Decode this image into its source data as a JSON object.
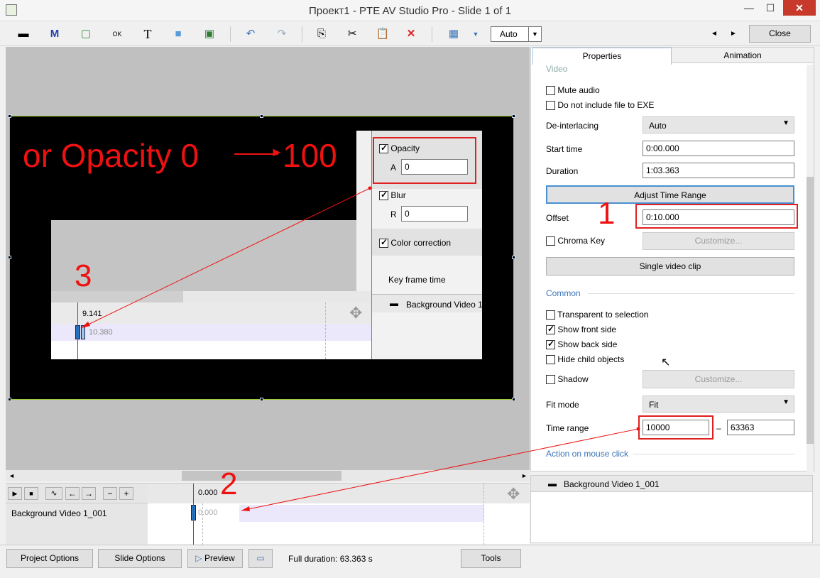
{
  "window": {
    "title": "Проект1 - PTE AV Studio Pro - Slide 1 of 1",
    "min": "—",
    "max": "☐",
    "close": "✕"
  },
  "toolbar": {
    "zoom_value": "Auto",
    "close_label": "Close",
    "prev": "◄",
    "next": "►"
  },
  "tabs": {
    "properties": "Properties",
    "animation": "Animation"
  },
  "props": {
    "video_section": "Video",
    "mute_audio": "Mute audio",
    "no_exe": "Do not include file to EXE",
    "deinterlacing_label": "De-interlacing",
    "deinterlacing_value": "Auto",
    "start_time_label": "Start time",
    "start_time_value": "0:00.000",
    "duration_label": "Duration",
    "duration_value": "1:03.363",
    "adjust_btn": "Adjust Time Range",
    "offset_label": "Offset",
    "offset_value": "0:10.000",
    "chroma_key": "Chroma Key",
    "customize": "Customize...",
    "single_clip": "Single video clip",
    "common_section": "Common",
    "transparent": "Transparent to selection",
    "show_front": "Show front side",
    "show_back": "Show back side",
    "hide_child": "Hide child objects",
    "shadow": "Shadow",
    "customize2": "Customize...",
    "fit_mode_label": "Fit mode",
    "fit_mode_value": "Fit",
    "time_range_label": "Time range",
    "time_range_from": "10000",
    "time_range_dash": "–",
    "time_range_to": "63363",
    "action_section": "Action on mouse click",
    "object_item": "Background Video 1_001"
  },
  "inner": {
    "opacity_label": "Opacity",
    "opacity_a": "A",
    "opacity_value": "0",
    "blur_label": "Blur",
    "blur_r": "R",
    "blur_value": "0",
    "color_corr": "Color correction",
    "keyframe_time": "Key frame time",
    "bg_video": "Background Video 1_",
    "time_9141": "9.141",
    "time_10380": "10.380"
  },
  "annotations": {
    "big_text": "or Opacity 0",
    "big_text_end": "100",
    "num1": "1",
    "num2": "2",
    "num3": "3"
  },
  "timeline": {
    "time_000": "0.000",
    "track_name": "Background Video 1_001",
    "track_time": "0.000"
  },
  "bottom": {
    "project_options": "Project Options",
    "slide_options": "Slide Options",
    "preview": "Preview",
    "full_duration": "Full duration: 63.363 s",
    "tools": "Tools"
  },
  "colors": {
    "annotation_red": "#ee1111",
    "accent_blue": "#3b74b8"
  }
}
